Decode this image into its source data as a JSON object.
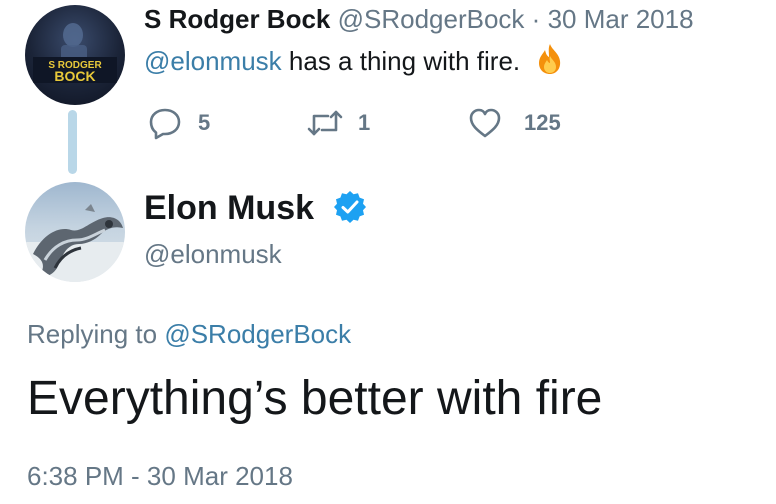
{
  "parent_tweet": {
    "avatar_text_line1": "S RODGER",
    "avatar_text_line2": "BOCK",
    "display_name": "S Rodger Bock",
    "handle": "@SRodgerBock",
    "separator": "·",
    "date": "30 Mar 2018",
    "mention": "@elonmusk",
    "text": " has a thing with fire.",
    "emoji_icon": "fire-icon",
    "actions": {
      "reply": {
        "icon": "reply-icon",
        "count": "5"
      },
      "retweet": {
        "icon": "retweet-icon",
        "count": "1"
      },
      "like": {
        "icon": "heart-icon",
        "count": "125"
      }
    }
  },
  "main_tweet": {
    "display_name": "Elon Musk",
    "verified_icon": "verified-badge-icon",
    "handle": "@elonmusk",
    "replying_prefix": "Replying to ",
    "replying_to": "@SRodgerBock",
    "text": "Everything’s better with fire",
    "timestamp": "6:38 PM - 30 Mar 2018"
  },
  "colors": {
    "text_primary": "#14171a",
    "text_secondary": "#657786",
    "link": "#3b7ea8",
    "thread_line": "#b9d7e8",
    "verified": "#1da1f2"
  }
}
